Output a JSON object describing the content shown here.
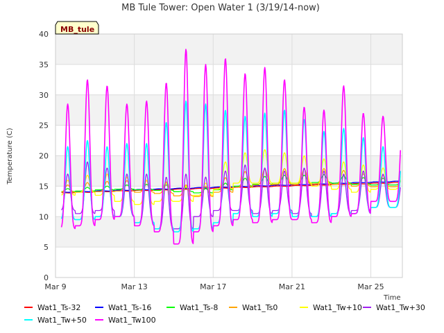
{
  "chart_data": {
    "type": "line",
    "title": "MB Tule Tower: Open Water 1 (3/19/14-now)",
    "xlabel": "Time",
    "ylabel": "Temperature (C)",
    "badge": "MB_tule",
    "xlim": [
      9,
      26.6
    ],
    "ylim": [
      0,
      40
    ],
    "yticks": [
      0,
      5,
      10,
      15,
      20,
      25,
      30,
      35,
      40
    ],
    "xticks": [
      {
        "value": 9,
        "label": "Mar 9"
      },
      {
        "value": 13,
        "label": "Mar 13"
      },
      {
        "value": 17,
        "label": "Mar 17"
      },
      {
        "value": 21,
        "label": "Mar 21"
      },
      {
        "value": 25,
        "label": "Mar 25"
      }
    ],
    "grid": true,
    "legend_position": "bottom",
    "x_day_start": 9.3,
    "x_day_end": 26.5,
    "series": [
      {
        "name": "Wat1_Ts-32",
        "color": "#ff0000",
        "kind": "trend",
        "start": 13.9,
        "end": 15.6
      },
      {
        "name": "Wat1_Ts-16",
        "color": "#0000ff",
        "kind": "trend",
        "start": 14.0,
        "end": 15.8
      },
      {
        "name": "Wat1_Ts-8",
        "color": "#00ff00",
        "kind": "diurnal",
        "daily_max": [
          14.6,
          14.8,
          15.0,
          15.2,
          15.3,
          15.2,
          14.8,
          14.6,
          15.5,
          16.3,
          16.6,
          16.8,
          16.8,
          16.9,
          16.7,
          16.4,
          16.3
        ],
        "daily_min": [
          14.1,
          14.2,
          14.4,
          14.5,
          14.4,
          14.3,
          14.1,
          13.9,
          14.4,
          15.0,
          15.3,
          15.5,
          15.5,
          15.6,
          15.5,
          15.3,
          15.2
        ]
      },
      {
        "name": "Wat1_Ts0",
        "color": "#ffa500",
        "kind": "diurnal",
        "daily_max": [
          15.2,
          15.6,
          15.8,
          15.9,
          15.9,
          15.7,
          15.2,
          15.0,
          16.4,
          17.4,
          17.8,
          17.9,
          17.8,
          17.9,
          17.6,
          17.0,
          16.8
        ],
        "daily_min": [
          14.0,
          14.0,
          14.1,
          14.2,
          14.0,
          13.8,
          13.4,
          13.3,
          14.0,
          14.8,
          15.2,
          15.3,
          15.3,
          15.4,
          15.3,
          15.0,
          14.9
        ]
      },
      {
        "name": "Wat1_Tw+10",
        "color": "#ffff00",
        "kind": "diurnal",
        "daily_max": [
          16.0,
          16.8,
          17.0,
          16.5,
          16.0,
          15.5,
          15.0,
          15.5,
          19.0,
          20.5,
          21.0,
          20.5,
          20.0,
          19.5,
          19.0,
          18.5,
          18.0
        ],
        "daily_min": [
          13.5,
          14.0,
          13.5,
          12.5,
          12.0,
          12.5,
          12.5,
          13.5,
          14.5,
          15.5,
          15.5,
          15.5,
          15.5,
          15.0,
          14.5,
          14.0,
          14.5
        ]
      },
      {
        "name": "Wat1_Tw+30",
        "color": "#a020f0",
        "kind": "diurnal",
        "daily_max": [
          17.0,
          19.0,
          18.0,
          17.0,
          17.0,
          16.5,
          17.0,
          16.5,
          17.5,
          18.5,
          18.0,
          17.5,
          18.0,
          17.5,
          17.0,
          17.5,
          17.0
        ],
        "daily_min": [
          11.0,
          10.5,
          11.0,
          10.0,
          9.0,
          8.0,
          8.0,
          10.0,
          11.0,
          11.0,
          10.5,
          11.0,
          10.5,
          10.0,
          10.5,
          11.0,
          11.5
        ]
      },
      {
        "name": "Wat1_Tw+50",
        "color": "#00ffff",
        "kind": "diurnal",
        "daily_max": [
          21.5,
          22.5,
          21.5,
          22.0,
          22.0,
          25.5,
          29.0,
          28.5,
          27.5,
          26.5,
          27.0,
          27.5,
          26.0,
          24.0,
          24.5,
          23.0,
          21.5
        ],
        "daily_min": [
          9.5,
          9.5,
          10.0,
          10.0,
          9.0,
          8.0,
          7.5,
          8.0,
          9.0,
          10.5,
          10.0,
          10.5,
          10.0,
          10.0,
          10.5,
          10.5,
          11.5
        ]
      },
      {
        "name": "Wat1_Tw100",
        "color": "#ff00ff",
        "kind": "diurnal",
        "daily_max": [
          28.5,
          32.5,
          31.5,
          28.5,
          29.0,
          32.0,
          37.5,
          35.0,
          36.0,
          33.5,
          34.5,
          32.5,
          28.0,
          27.5,
          31.5,
          27.0,
          26.5
        ],
        "daily_min": [
          8.0,
          8.5,
          9.5,
          10.0,
          8.5,
          7.5,
          5.5,
          7.5,
          8.5,
          9.5,
          9.0,
          9.5,
          9.5,
          9.0,
          10.0,
          10.5,
          12.5
        ]
      }
    ]
  }
}
